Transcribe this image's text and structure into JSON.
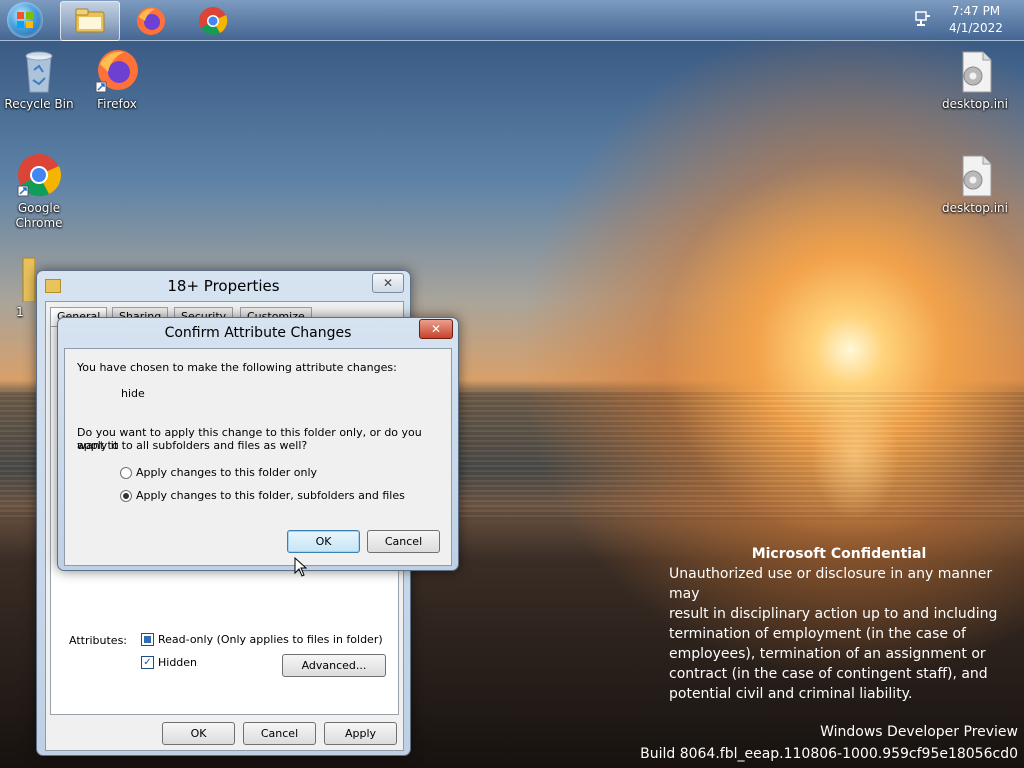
{
  "taskbar": {
    "clock_time": "7:47 PM",
    "clock_date": "4/1/2022"
  },
  "desktop_icons": {
    "recycle_bin": "Recycle Bin",
    "firefox": "Firefox",
    "chrome": "Google Chrome",
    "folder_partial": "1",
    "desktop_ini_1": "desktop.ini",
    "desktop_ini_2": "desktop.ini"
  },
  "properties_dialog": {
    "title": "18+ Properties",
    "close_label": "✕",
    "tabs": [
      "General",
      "Sharing",
      "Security",
      "Customize"
    ],
    "attributes_label": "Attributes:",
    "readonly_label": "Read-only (Only applies to files in folder)",
    "hidden_label": "Hidden",
    "advanced_label": "Advanced...",
    "ok_label": "OK",
    "cancel_label": "Cancel",
    "apply_label": "Apply"
  },
  "confirm_dialog": {
    "title": "Confirm Attribute Changes",
    "close_label": "✕",
    "intro": "You have chosen to make the following attribute changes:",
    "change": "hide",
    "question_line1": "Do you want to apply this change to this folder only, or do you want to",
    "question_line2": "apply it to all subfolders and files as well?",
    "option_folder_only": "Apply changes to this folder only",
    "option_all": "Apply changes to this folder, subfolders and files",
    "selected_option": "option_all",
    "ok_label": "OK",
    "cancel_label": "Cancel"
  },
  "watermark": {
    "title": "Microsoft Confidential",
    "line1": "Unauthorized use or disclosure in any manner may",
    "line2": "result in disciplinary action up to and including",
    "line3": "termination of employment (in the case of",
    "line4": "employees), termination of an assignment or",
    "line5": "contract (in the case of contingent staff), and",
    "line6": "potential civil and criminal liability.",
    "product": "Windows Developer Preview",
    "build": "Build 8064.fbl_eeap.110806-1000.959cf95e18056cd0"
  }
}
